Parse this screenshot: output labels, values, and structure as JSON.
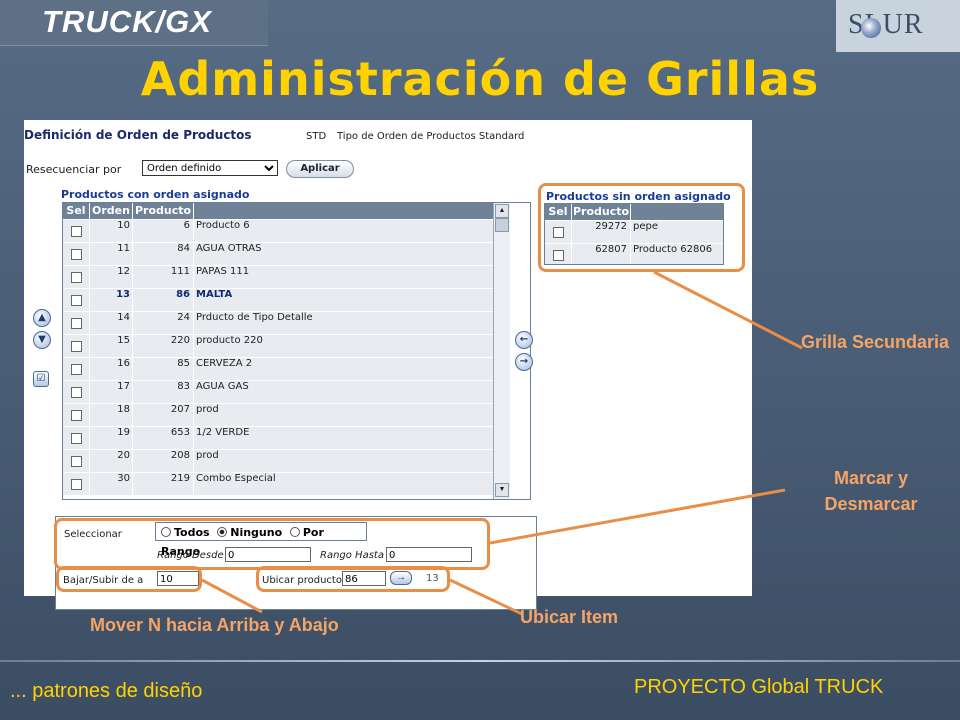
{
  "header": {
    "logo_left": "TRUCK/GX",
    "logo_right": "SOLUR",
    "title": "Administración de Grillas"
  },
  "screen": {
    "heading": "Definición de Orden de Productos",
    "type_code": "STD",
    "type_desc": "Tipo de Orden de Productos Standard",
    "resequence_label": "Resecuenciar por",
    "resequence_value": "Orden definido",
    "apply_label": "Aplicar",
    "assigned_title": "Productos con orden asignado",
    "unassigned_title": "Productos sin orden asignado",
    "main_grid": {
      "columns": [
        "Sel",
        "Orden",
        "Producto",
        ""
      ],
      "rows": [
        {
          "orden": "10",
          "code": "6",
          "name": "Producto 6",
          "bold": false
        },
        {
          "orden": "11",
          "code": "84",
          "name": "AGUA OTRAS",
          "bold": false
        },
        {
          "orden": "12",
          "code": "111",
          "name": "PAPAS 111",
          "bold": false
        },
        {
          "orden": "13",
          "code": "86",
          "name": "MALTA",
          "bold": true
        },
        {
          "orden": "14",
          "code": "24",
          "name": "Prducto de Tipo Detalle",
          "bold": false
        },
        {
          "orden": "15",
          "code": "220",
          "name": "producto 220",
          "bold": false
        },
        {
          "orden": "16",
          "code": "85",
          "name": "CERVEZA 2",
          "bold": false
        },
        {
          "orden": "17",
          "code": "83",
          "name": "AGUA GAS",
          "bold": false
        },
        {
          "orden": "18",
          "code": "207",
          "name": "prod",
          "bold": false
        },
        {
          "orden": "19",
          "code": "653",
          "name": "1/2 VERDE",
          "bold": false
        },
        {
          "orden": "20",
          "code": "208",
          "name": "prod",
          "bold": false
        },
        {
          "orden": "30",
          "code": "219",
          "name": "Combo Especial",
          "bold": false
        }
      ]
    },
    "side_grid": {
      "columns": [
        "Sel",
        "Producto"
      ],
      "rows": [
        {
          "code": "29272",
          "name": "pepe"
        },
        {
          "code": "62807",
          "name": "Producto 62806"
        }
      ]
    },
    "select_label": "Seleccionar",
    "radio_options": [
      "Todos",
      "Ninguno",
      "Por Rango"
    ],
    "radio_selected": "Ninguno",
    "range_from_label": "Rango Desde",
    "range_from_value": "0",
    "range_to_label": "Rango Hasta",
    "range_to_value": "0",
    "move_label": "Bajar/Subir de a",
    "move_value": "10",
    "locate_label": "Ubicar producto",
    "locate_value": "86",
    "locate_result": "13"
  },
  "annotations": {
    "secondary_grid": "Grilla Secundaria",
    "mark_unmark": "Marcar y Desmarcar",
    "locate_item": "Ubicar Item",
    "move_n": "Mover N hacia Arriba y Abajo"
  },
  "footer": {
    "left": "... patrones de diseño",
    "right": "PROYECTO Global TRUCK"
  },
  "colors": {
    "title": "#ffd200",
    "annotation": "#f4a466",
    "callout": "#e98e47",
    "grid_header": "#6f8297"
  }
}
